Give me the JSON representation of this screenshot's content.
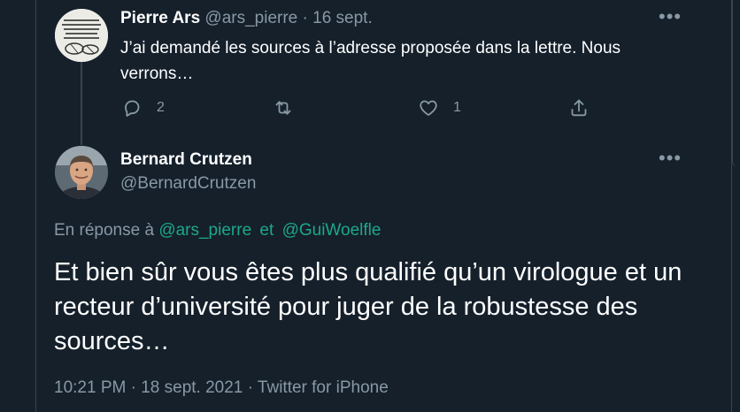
{
  "tweet1": {
    "name": "Pierre Ars",
    "handle": "@ars_pierre",
    "separator": "·",
    "date": "16 sept.",
    "text": "J’ai demandé les sources à l’adresse proposée dans la lettre.  Nous verrons…",
    "more_icon": "more-horizontal-icon",
    "actions": {
      "reply_count": "2",
      "retweet_count": "",
      "like_count": "1",
      "share_count": ""
    }
  },
  "tweet2": {
    "name": "Bernard Crutzen",
    "handle": "@BernardCrutzen",
    "more_icon": "more-horizontal-icon",
    "reply_prefix": "En réponse à",
    "mention1": "@ars_pierre",
    "mention_joiner": "et",
    "mention2": "@GuiWoelfle",
    "text": "Et bien sûr vous êtes plus qualifié qu’un virologue et un recteur d’université pour juger de la robustesse des sources…",
    "time": "10:21 PM",
    "meta_sep1": "·",
    "date": "18 sept. 2021",
    "meta_sep2": "·",
    "source": "Twitter for iPhone"
  },
  "colors": {
    "background": "#15202b",
    "border": "#38444d",
    "muted": "#8899a6",
    "mention": "#1da88a",
    "text": "#ffffff"
  }
}
